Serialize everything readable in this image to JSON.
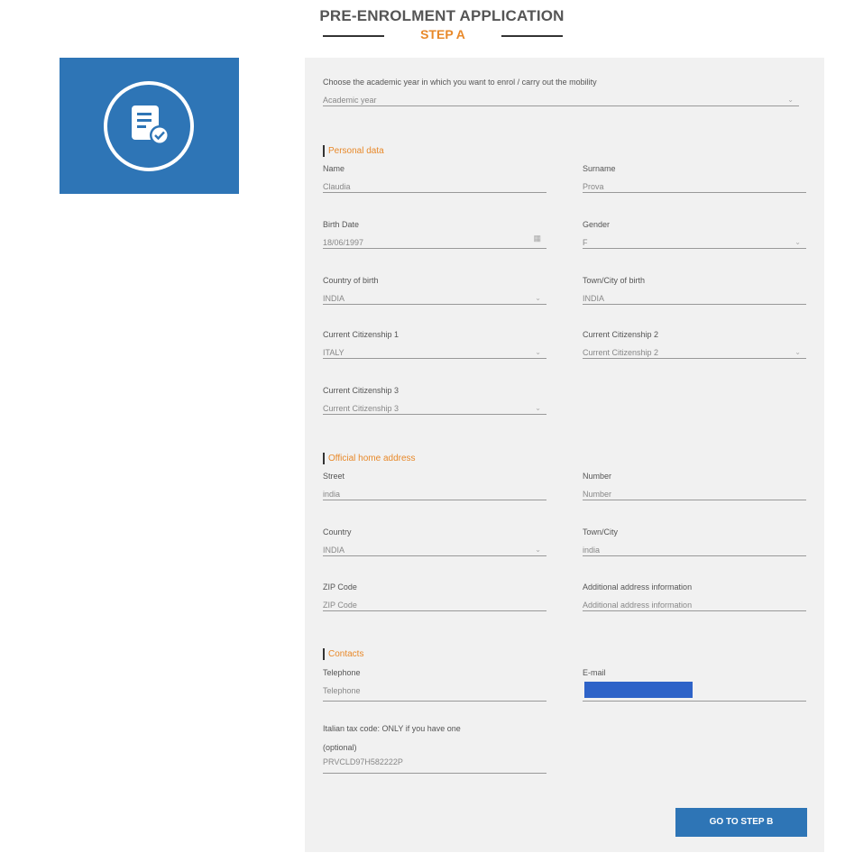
{
  "header": {
    "title": "PRE-ENROLMENT APPLICATION",
    "step": "STEP A"
  },
  "academic_year": {
    "label": "Choose the academic year in which you want to enrol / carry out the mobility",
    "placeholder": "Academic year"
  },
  "sections": {
    "personal": "Personal data",
    "address": "Official home address",
    "contacts": "Contacts"
  },
  "personal": {
    "name": {
      "label": "Name",
      "value": "Claudia"
    },
    "surname": {
      "label": "Surname",
      "value": "Prova"
    },
    "birth_date": {
      "label": "Birth Date",
      "value": "18/06/1997"
    },
    "gender": {
      "label": "Gender",
      "value": "F"
    },
    "country_of_birth": {
      "label": "Country of birth",
      "value": "INDIA"
    },
    "city_of_birth": {
      "label": "Town/City of birth",
      "value": "INDIA"
    },
    "citizenship1": {
      "label": "Current Citizenship 1",
      "value": "ITALY"
    },
    "citizenship2": {
      "label": "Current Citizenship 2",
      "placeholder": "Current Citizenship 2"
    },
    "citizenship3": {
      "label": "Current Citizenship 3",
      "placeholder": "Current Citizenship 3"
    }
  },
  "address": {
    "street": {
      "label": "Street",
      "value": "india"
    },
    "number": {
      "label": "Number",
      "placeholder": "Number"
    },
    "country": {
      "label": "Country",
      "value": "INDIA"
    },
    "city": {
      "label": "Town/City",
      "value": "india"
    },
    "zip": {
      "label": "ZIP Code",
      "placeholder": "ZIP Code"
    },
    "additional": {
      "label": "Additional address information",
      "placeholder": "Additional address information"
    }
  },
  "contacts": {
    "telephone": {
      "label": "Telephone",
      "placeholder": "Telephone"
    },
    "email": {
      "label": "E-mail"
    },
    "tax_code": {
      "label_line1": "Italian tax code: ONLY if you have one",
      "label_line2": "(optional)",
      "value": "PRVCLD97H582222P"
    }
  },
  "actions": {
    "next_label": "GO TO STEP B"
  },
  "colors": {
    "accent": "#e8892a",
    "brand_blue": "#2e75b6",
    "panel_bg": "#f1f1f1"
  },
  "icons": {
    "logo": "document-check-icon",
    "dropdown": "chevron-down-icon",
    "calendar": "calendar-icon"
  }
}
